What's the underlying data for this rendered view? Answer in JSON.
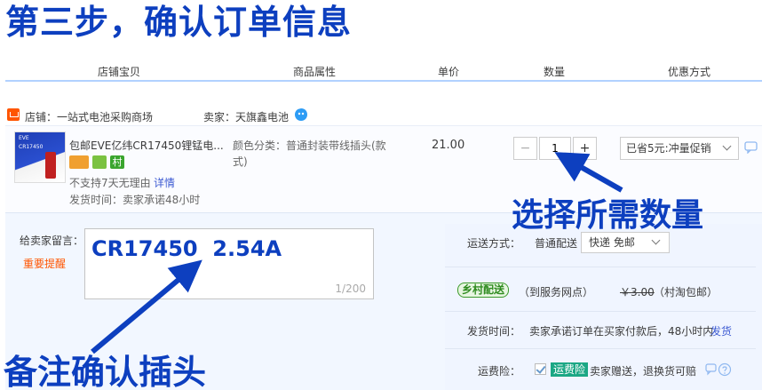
{
  "headline": "第三步，确认订单信息",
  "columns": [
    "店铺宝贝",
    "商品属性",
    "单价",
    "数量",
    "优惠方式"
  ],
  "shop": {
    "name": "店铺：一站式电池采购商场",
    "seller": "卖家：天旗鑫电池"
  },
  "item": {
    "title": "包邮EVE亿纬CR17450锂锰电...",
    "thumb_label": "EVE",
    "thumb_text": "CR17450",
    "badge_village": "村",
    "return_policy": "不支持7天无理由",
    "details_link": "详情",
    "delivery": "发货时间：卖家承诺48小时",
    "attr": "颜色分类：普通封装带线插头(款式)",
    "price": "21.00",
    "qty_minus": "−",
    "qty_value": "1",
    "qty_plus": "+",
    "promo": "已省5元:冲量促销"
  },
  "annotations": {
    "select_qty": "选择所需数量",
    "note_confirm": "备注确认插头",
    "message_text": "CR17450  2.54A"
  },
  "message": {
    "label": "给卖家留言：",
    "reminder": "重要提醒",
    "counter": "1/200"
  },
  "shipping": {
    "label": "运送方式：",
    "method": "普通配送",
    "select_value": "快递 免邮",
    "village_badge": "乡村配送",
    "village_desc": "（到服务网点）",
    "old_price": "￥3.00",
    "village_note": "（村淘包邮）",
    "time_label": "发货时间：",
    "time_text": "卖家承诺订单在买家付款后，48小时内",
    "time_link": "发货",
    "insurance_label": "运费险：",
    "insurance_tag": "运费险",
    "insurance_text": "卖家赠送，退换货可赔"
  },
  "colors": {
    "annotation_blue": "#0d3fbf",
    "link_blue": "#3c5ad2",
    "shop_orange": "#ff5500",
    "reminder_red": "#ff5500",
    "village_green": "#2e8b1f"
  }
}
